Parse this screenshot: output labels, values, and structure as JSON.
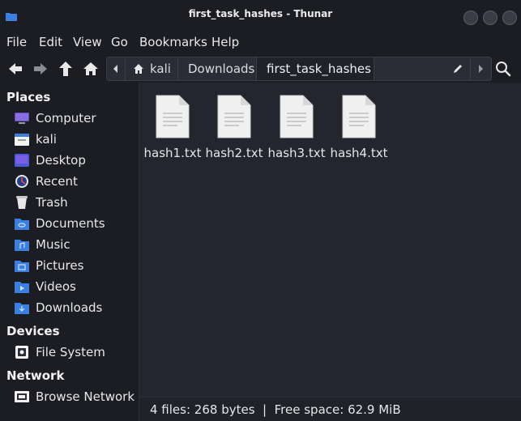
{
  "window": {
    "title": "first_task_hashes - Thunar"
  },
  "menubar": {
    "items": [
      "File",
      "Edit",
      "View",
      "Go",
      "Bookmarks",
      "Help"
    ]
  },
  "toolbar": {
    "breadcrumbs": [
      "kali",
      "Downloads",
      "first_task_hashes"
    ],
    "icons": [
      "back-arrow-icon",
      "forward-arrow-icon",
      "up-arrow-icon",
      "home-icon",
      "scroll-left-icon",
      "edit-path-icon",
      "scroll-right-icon",
      "search-icon"
    ]
  },
  "sidebar": {
    "places_title": "Places",
    "places": [
      {
        "label": "Computer",
        "icon": "computer-icon"
      },
      {
        "label": "kali",
        "icon": "home-folder-icon"
      },
      {
        "label": "Desktop",
        "icon": "desktop-icon"
      },
      {
        "label": "Recent",
        "icon": "recent-icon"
      },
      {
        "label": "Trash",
        "icon": "trash-icon"
      },
      {
        "label": "Documents",
        "icon": "documents-folder-icon"
      },
      {
        "label": "Music",
        "icon": "music-folder-icon"
      },
      {
        "label": "Pictures",
        "icon": "pictures-folder-icon"
      },
      {
        "label": "Videos",
        "icon": "videos-folder-icon"
      },
      {
        "label": "Downloads",
        "icon": "downloads-folder-icon"
      }
    ],
    "devices_title": "Devices",
    "devices": [
      {
        "label": "File System",
        "icon": "drive-icon"
      }
    ],
    "network_title": "Network",
    "network": [
      {
        "label": "Browse Network",
        "icon": "network-icon"
      }
    ]
  },
  "files": [
    {
      "name": "hash1.txt",
      "icon": "text-file-icon"
    },
    {
      "name": "hash2.txt",
      "icon": "text-file-icon"
    },
    {
      "name": "hash3.txt",
      "icon": "text-file-icon"
    },
    {
      "name": "hash4.txt",
      "icon": "text-file-icon"
    }
  ],
  "status": {
    "text": "4 files: 268 bytes  |  Free space: 62.9 MiB"
  },
  "colors": {
    "folder_blue": "#3b7fe0",
    "window_bg": "#1b1d23",
    "content_bg": "#23262e"
  }
}
